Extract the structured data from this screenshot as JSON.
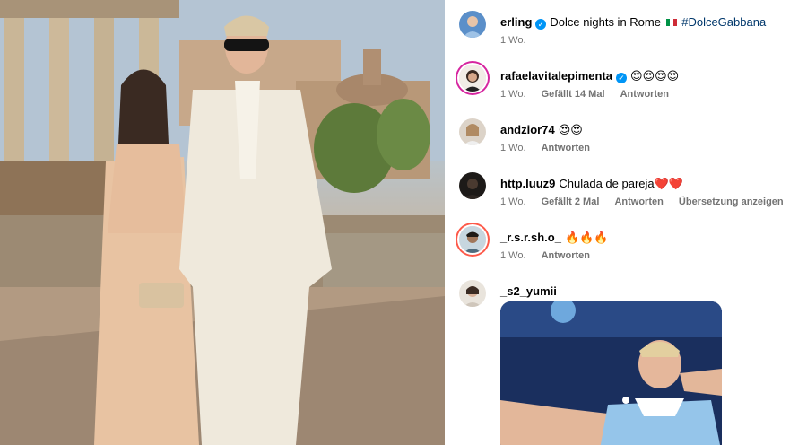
{
  "post": {
    "image_alt": "Couple posing in front of Roman ruins"
  },
  "caption": {
    "username": "erling",
    "verified": true,
    "text": "Dolce nights in Rome",
    "flag": "🇮🇹",
    "hashtag": "#DolceGabbana",
    "time": "1 Wo."
  },
  "comments": [
    {
      "username": "rafaelavitalepimenta",
      "verified": true,
      "text": "😍😍😍😍",
      "time": "1 Wo.",
      "likes": "Gefällt 14 Mal",
      "reply": "Antworten",
      "translate": ""
    },
    {
      "username": "andzior74",
      "verified": false,
      "text": "😍😍",
      "time": "1 Wo.",
      "likes": "",
      "reply": "Antworten",
      "translate": ""
    },
    {
      "username": "http.luuz9",
      "verified": false,
      "text": "Chulada de pareja❤️❤️",
      "time": "1 Wo.",
      "likes": "Gefällt 2 Mal",
      "reply": "Antworten",
      "translate": "Übersetzung anzeigen"
    },
    {
      "username": "_r.s.r.sh.o_",
      "verified": false,
      "text": "🔥🔥🔥",
      "time": "1 Wo.",
      "likes": "",
      "reply": "Antworten",
      "translate": ""
    },
    {
      "username": "_s2_yumii",
      "verified": false,
      "text": "",
      "time": "",
      "likes": "",
      "reply": "",
      "translate": ""
    }
  ],
  "colors": {
    "verified": "#0095f6",
    "hashtag": "#00376b",
    "meta": "#737373",
    "story_ring": "#d6249f"
  }
}
